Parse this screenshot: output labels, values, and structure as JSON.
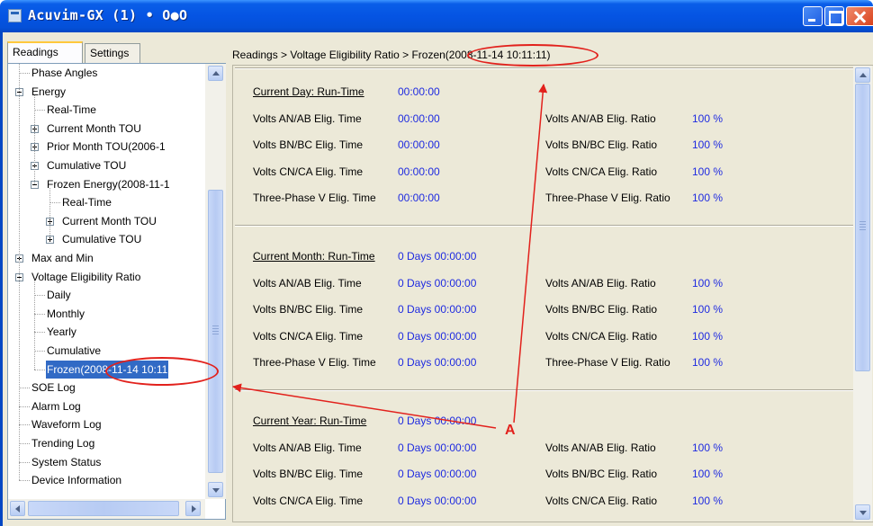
{
  "window": {
    "title": "Acuvim-GX (1) • O●O",
    "buttons": [
      "minimize",
      "maximize",
      "close"
    ]
  },
  "tabs": [
    {
      "label": "Readings",
      "active": true
    },
    {
      "label": "Settings",
      "active": false
    }
  ],
  "tree": {
    "items": [
      {
        "label": "Phase Angles"
      },
      {
        "label": "Energy",
        "expander": "minus"
      },
      {
        "label": "Real-Time"
      },
      {
        "label": "Current Month TOU",
        "expander": "plus"
      },
      {
        "label": "Prior Month TOU(2006-1",
        "expander": "plus"
      },
      {
        "label": "Cumulative TOU",
        "expander": "plus"
      },
      {
        "label": "Frozen Energy(2008-11-1",
        "expander": "minus"
      },
      {
        "label": "Real-Time"
      },
      {
        "label": "Current Month TOU",
        "expander": "plus"
      },
      {
        "label": "Cumulative TOU",
        "expander": "plus"
      },
      {
        "label": "Max and Min",
        "expander": "plus"
      },
      {
        "label": "Voltage Eligibility Ratio",
        "expander": "minus"
      },
      {
        "label": "Daily"
      },
      {
        "label": "Monthly"
      },
      {
        "label": "Yearly"
      },
      {
        "label": "Cumulative"
      },
      {
        "label": "Frozen(2008-11-14 10:11",
        "selected": true
      },
      {
        "label": "SOE Log"
      },
      {
        "label": "Alarm Log"
      },
      {
        "label": "Waveform Log"
      },
      {
        "label": "Trending Log"
      },
      {
        "label": "System Status"
      },
      {
        "label": "Device Information"
      }
    ]
  },
  "breadcrumb": "Readings > Voltage Eligibility Ratio > Frozen(2008-11-14 10:11:11)",
  "sections": [
    {
      "header_label": "Current Day: Run-Time",
      "header_value": "00:00:00",
      "rows": [
        {
          "time_label": "Volts AN/AB Elig. Time",
          "time_value": "00:00:00",
          "ratio_label": "Volts AN/AB Elig. Ratio",
          "ratio_value": "100 %"
        },
        {
          "time_label": "Volts BN/BC Elig. Time",
          "time_value": "00:00:00",
          "ratio_label": "Volts BN/BC Elig. Ratio",
          "ratio_value": "100 %"
        },
        {
          "time_label": "Volts CN/CA Elig. Time",
          "time_value": "00:00:00",
          "ratio_label": "Volts CN/CA Elig. Ratio",
          "ratio_value": "100 %"
        },
        {
          "time_label": "Three-Phase V Elig. Time",
          "time_value": "00:00:00",
          "ratio_label": "Three-Phase V Elig. Ratio",
          "ratio_value": "100 %"
        }
      ]
    },
    {
      "header_label": "Current Month: Run-Time",
      "header_value": "0 Days 00:00:00",
      "rows": [
        {
          "time_label": "Volts AN/AB Elig. Time",
          "time_value": "0 Days 00:00:00",
          "ratio_label": "Volts AN/AB Elig. Ratio",
          "ratio_value": "100 %"
        },
        {
          "time_label": "Volts BN/BC Elig. Time",
          "time_value": "0 Days 00:00:00",
          "ratio_label": "Volts BN/BC Elig. Ratio",
          "ratio_value": "100 %"
        },
        {
          "time_label": "Volts CN/CA Elig. Time",
          "time_value": "0 Days 00:00:00",
          "ratio_label": "Volts CN/CA Elig. Ratio",
          "ratio_value": "100 %"
        },
        {
          "time_label": "Three-Phase V Elig. Time",
          "time_value": "0 Days 00:00:00",
          "ratio_label": "Three-Phase V Elig. Ratio",
          "ratio_value": "100 %"
        }
      ]
    },
    {
      "header_label": "Current Year: Run-Time",
      "header_value": "0 Days 00:00:00",
      "rows": [
        {
          "time_label": "Volts AN/AB Elig. Time",
          "time_value": "0 Days 00:00:00",
          "ratio_label": "Volts AN/AB Elig. Ratio",
          "ratio_value": "100 %"
        },
        {
          "time_label": "Volts BN/BC Elig. Time",
          "time_value": "0 Days 00:00:00",
          "ratio_label": "Volts BN/BC Elig. Ratio",
          "ratio_value": "100 %"
        },
        {
          "time_label": "Volts CN/CA Elig. Time",
          "time_value": "0 Days 00:00:00",
          "ratio_label": "Volts CN/CA Elig. Ratio",
          "ratio_value": "100 %"
        }
      ]
    }
  ],
  "annotation": {
    "label": "A",
    "color": "#e2211c"
  },
  "colors": {
    "titlebar": "#0554e3",
    "value_text": "#1f2be0",
    "selection": "#316ac5"
  }
}
